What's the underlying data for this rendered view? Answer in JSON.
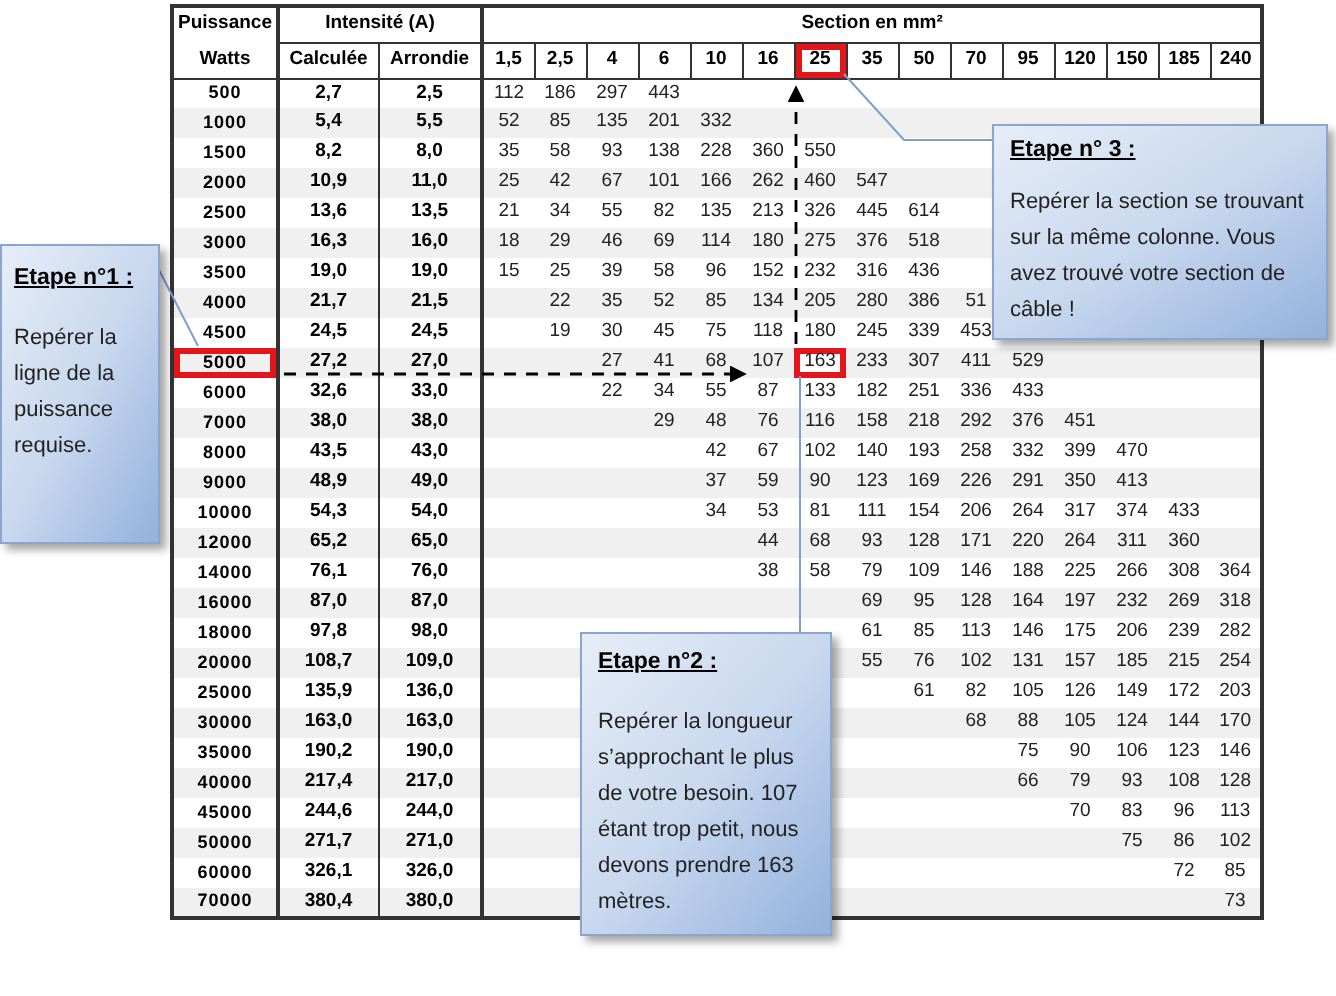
{
  "table": {
    "header": {
      "puissance": "Puissance",
      "watts": "Watts",
      "intensite": "Intensité (A)",
      "calculee": "Calculée",
      "arrondie": "Arrondie",
      "section": "Section en mm²"
    },
    "sections": [
      {
        "label": "1,5",
        "selected": false
      },
      {
        "label": "2,5",
        "selected": false
      },
      {
        "label": "4",
        "selected": false
      },
      {
        "label": "6",
        "selected": false
      },
      {
        "label": "10",
        "selected": false
      },
      {
        "label": "16",
        "selected": false
      },
      {
        "label": "25",
        "selected": true
      },
      {
        "label": "35",
        "selected": false
      },
      {
        "label": "50",
        "selected": false
      },
      {
        "label": "70",
        "selected": false
      },
      {
        "label": "95",
        "selected": false
      },
      {
        "label": "120",
        "selected": false
      },
      {
        "label": "150",
        "selected": false
      },
      {
        "label": "185",
        "selected": false
      },
      {
        "label": "240",
        "selected": false
      }
    ],
    "rows": [
      {
        "puissance": "500",
        "calculee": "2,7",
        "arrondie": "2,5",
        "selected": false,
        "values": {
          "col_1": "112",
          "col_2": "186",
          "col_3": "297",
          "col_4": "443"
        }
      },
      {
        "puissance": "1000",
        "calculee": "5,4",
        "arrondie": "5,5",
        "selected": false,
        "values": {
          "col_1": "52",
          "col_2": "85",
          "col_3": "135",
          "col_4": "201",
          "col_5": "332"
        }
      },
      {
        "puissance": "1500",
        "calculee": "8,2",
        "arrondie": "8,0",
        "selected": false,
        "values": {
          "col_1": "35",
          "col_2": "58",
          "col_3": "93",
          "col_4": "138",
          "col_5": "228",
          "col_6": "360",
          "col_7": "550"
        }
      },
      {
        "puissance": "2000",
        "calculee": "10,9",
        "arrondie": "11,0",
        "selected": false,
        "values": {
          "col_1": "25",
          "col_2": "42",
          "col_3": "67",
          "col_4": "101",
          "col_5": "166",
          "col_6": "262",
          "col_7": "460",
          "col_8": "547"
        }
      },
      {
        "puissance": "2500",
        "calculee": "13,6",
        "arrondie": "13,5",
        "selected": false,
        "values": {
          "col_1": "21",
          "col_2": "34",
          "col_3": "55",
          "col_4": "82",
          "col_5": "135",
          "col_6": "213",
          "col_7": "326",
          "col_8": "445",
          "col_9": "614"
        }
      },
      {
        "puissance": "3000",
        "calculee": "16,3",
        "arrondie": "16,0",
        "selected": false,
        "values": {
          "col_1": "18",
          "col_2": "29",
          "col_3": "46",
          "col_4": "69",
          "col_5": "114",
          "col_6": "180",
          "col_7": "275",
          "col_8": "376",
          "col_9": "518"
        }
      },
      {
        "puissance": "3500",
        "calculee": "19,0",
        "arrondie": "19,0",
        "selected": false,
        "values": {
          "col_1": "15",
          "col_2": "25",
          "col_3": "39",
          "col_4": "58",
          "col_5": "96",
          "col_6": "152",
          "col_7": "232",
          "col_8": "316",
          "col_9": "436"
        }
      },
      {
        "puissance": "4000",
        "calculee": "21,7",
        "arrondie": "21,5",
        "selected": false,
        "values": {
          "col_2": "22",
          "col_3": "35",
          "col_4": "52",
          "col_5": "85",
          "col_6": "134",
          "col_7": "205",
          "col_8": "280",
          "col_9": "386",
          "col_10": "51"
        }
      },
      {
        "puissance": "4500",
        "calculee": "24,5",
        "arrondie": "24,5",
        "selected": false,
        "values": {
          "col_2": "19",
          "col_3": "30",
          "col_4": "45",
          "col_5": "75",
          "col_6": "118",
          "col_7": "180",
          "col_8": "245",
          "col_9": "339",
          "col_10": "453"
        }
      },
      {
        "puissance": "5000",
        "calculee": "27,2",
        "arrondie": "27,0",
        "selected": true,
        "values": {
          "col_3": "27",
          "col_4": "41",
          "col_5": "68",
          "col_6": "107",
          "col_7": "163",
          "col_8": "233",
          "col_9": "307",
          "col_10": "411",
          "col_11": "529"
        }
      },
      {
        "puissance": "6000",
        "calculee": "32,6",
        "arrondie": "33,0",
        "selected": false,
        "values": {
          "col_3": "22",
          "col_4": "34",
          "col_5": "55",
          "col_6": "87",
          "col_7": "133",
          "col_8": "182",
          "col_9": "251",
          "col_10": "336",
          "col_11": "433"
        }
      },
      {
        "puissance": "7000",
        "calculee": "38,0",
        "arrondie": "38,0",
        "selected": false,
        "values": {
          "col_4": "29",
          "col_5": "48",
          "col_6": "76",
          "col_7": "116",
          "col_8": "158",
          "col_9": "218",
          "col_10": "292",
          "col_11": "376",
          "col_12": "451"
        }
      },
      {
        "puissance": "8000",
        "calculee": "43,5",
        "arrondie": "43,0",
        "selected": false,
        "values": {
          "col_5": "42",
          "col_6": "67",
          "col_7": "102",
          "col_8": "140",
          "col_9": "193",
          "col_10": "258",
          "col_11": "332",
          "col_12": "399",
          "col_13": "470"
        }
      },
      {
        "puissance": "9000",
        "calculee": "48,9",
        "arrondie": "49,0",
        "selected": false,
        "values": {
          "col_5": "37",
          "col_6": "59",
          "col_7": "90",
          "col_8": "123",
          "col_9": "169",
          "col_10": "226",
          "col_11": "291",
          "col_12": "350",
          "col_13": "413"
        }
      },
      {
        "puissance": "10000",
        "calculee": "54,3",
        "arrondie": "54,0",
        "selected": false,
        "values": {
          "col_5": "34",
          "col_6": "53",
          "col_7": "81",
          "col_8": "111",
          "col_9": "154",
          "col_10": "206",
          "col_11": "264",
          "col_12": "317",
          "col_13": "374",
          "col_14": "433"
        }
      },
      {
        "puissance": "12000",
        "calculee": "65,2",
        "arrondie": "65,0",
        "selected": false,
        "values": {
          "col_6": "44",
          "col_7": "68",
          "col_8": "93",
          "col_9": "128",
          "col_10": "171",
          "col_11": "220",
          "col_12": "264",
          "col_13": "311",
          "col_14": "360"
        }
      },
      {
        "puissance": "14000",
        "calculee": "76,1",
        "arrondie": "76,0",
        "selected": false,
        "values": {
          "col_6": "38",
          "col_7": "58",
          "col_8": "79",
          "col_9": "109",
          "col_10": "146",
          "col_11": "188",
          "col_12": "225",
          "col_13": "266",
          "col_14": "308",
          "col_15": "364"
        }
      },
      {
        "puissance": "16000",
        "calculee": "87,0",
        "arrondie": "87,0",
        "selected": false,
        "values": {
          "col_8": "69",
          "col_9": "95",
          "col_10": "128",
          "col_11": "164",
          "col_12": "197",
          "col_13": "232",
          "col_14": "269",
          "col_15": "318"
        }
      },
      {
        "puissance": "18000",
        "calculee": "97,8",
        "arrondie": "98,0",
        "selected": false,
        "values": {
          "col_8": "61",
          "col_9": "85",
          "col_10": "113",
          "col_11": "146",
          "col_12": "175",
          "col_13": "206",
          "col_14": "239",
          "col_15": "282"
        }
      },
      {
        "puissance": "20000",
        "calculee": "108,7",
        "arrondie": "109,0",
        "selected": false,
        "values": {
          "col_8": "55",
          "col_9": "76",
          "col_10": "102",
          "col_11": "131",
          "col_12": "157",
          "col_13": "185",
          "col_14": "215",
          "col_15": "254"
        }
      },
      {
        "puissance": "25000",
        "calculee": "135,9",
        "arrondie": "136,0",
        "selected": false,
        "values": {
          "col_9": "61",
          "col_10": "82",
          "col_11": "105",
          "col_12": "126",
          "col_13": "149",
          "col_14": "172",
          "col_15": "203"
        }
      },
      {
        "puissance": "30000",
        "calculee": "163,0",
        "arrondie": "163,0",
        "selected": false,
        "values": {
          "col_10": "68",
          "col_11": "88",
          "col_12": "105",
          "col_13": "124",
          "col_14": "144",
          "col_15": "170"
        }
      },
      {
        "puissance": "35000",
        "calculee": "190,2",
        "arrondie": "190,0",
        "selected": false,
        "values": {
          "col_11": "75",
          "col_12": "90",
          "col_13": "106",
          "col_14": "123",
          "col_15": "146"
        }
      },
      {
        "puissance": "40000",
        "calculee": "217,4",
        "arrondie": "217,0",
        "selected": false,
        "values": {
          "col_11": "66",
          "col_12": "79",
          "col_13": "93",
          "col_14": "108",
          "col_15": "128"
        }
      },
      {
        "puissance": "45000",
        "calculee": "244,6",
        "arrondie": "244,0",
        "selected": false,
        "values": {
          "col_12": "70",
          "col_13": "83",
          "col_14": "96",
          "col_15": "113"
        }
      },
      {
        "puissance": "50000",
        "calculee": "271,7",
        "arrondie": "271,0",
        "selected": false,
        "values": {
          "col_13": "75",
          "col_14": "86",
          "col_15": "102"
        }
      },
      {
        "puissance": "60000",
        "calculee": "326,1",
        "arrondie": "326,0",
        "selected": false,
        "values": {
          "col_14": "72",
          "col_15": "85"
        }
      },
      {
        "puissance": "70000",
        "calculee": "380,4",
        "arrondie": "380,0",
        "selected": false,
        "values": {
          "col_15": "73"
        }
      }
    ]
  },
  "callouts": {
    "step_3": {
      "title": "Etape n° 3 :",
      "text": "Repérer la section se trouvant sur la même colonne. Vous avez trouvé votre section de câble !"
    },
    "step_1": {
      "title": "Etape n°1 :",
      "text": "Repérer la ligne de la puissance requise."
    },
    "step_2": {
      "title": "Etape n°2 :",
      "text": "Repérer la longueur s’approchant le plus de votre besoin. 107 étant trop petit, nous devons prendre 163 mètres."
    }
  }
}
